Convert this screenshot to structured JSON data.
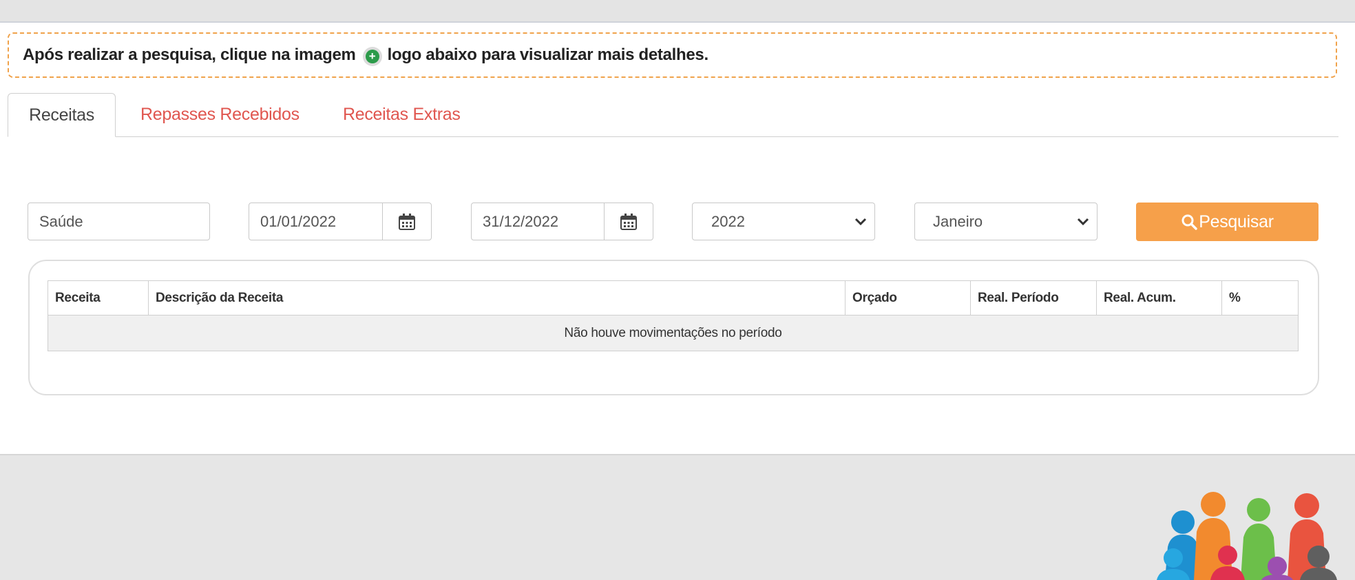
{
  "notice": {
    "text_before": "Após realizar a pesquisa, clique na imagem",
    "text_after": "logo abaixo para visualizar mais detalhes."
  },
  "tabs": [
    {
      "label": "Receitas",
      "active": true
    },
    {
      "label": "Repasses Recebidos",
      "active": false
    },
    {
      "label": "Receitas Extras",
      "active": false
    }
  ],
  "filters": {
    "category": "Saúde",
    "date_start": "01/01/2022",
    "date_end": "31/12/2022",
    "year": "2022",
    "month": "Janeiro",
    "search_label": "Pesquisar"
  },
  "table": {
    "columns": [
      "Receita",
      "Descrição da Receita",
      "Orçado",
      "Real. Período",
      "Real. Acum.",
      "%"
    ],
    "empty_message": "Não houve movimentações no período"
  },
  "colors": {
    "accent_orange": "#f6a04a",
    "tab_link": "#e0564f",
    "plus_green": "#2c9b4a"
  }
}
